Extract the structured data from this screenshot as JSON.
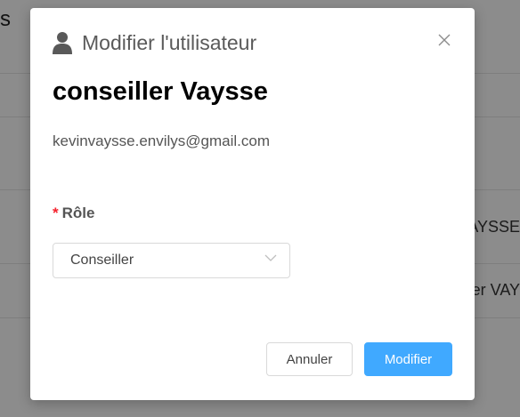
{
  "background": {
    "title_fragment": "s",
    "row_cells": [
      "AYSSE",
      "er VAY"
    ]
  },
  "modal": {
    "title": "Modifier l'utilisateur",
    "user_icon": "user-icon",
    "close_icon": "close-icon",
    "user_name": "conseiller Vaysse",
    "email": "kevinvaysse.envilys@gmail.com",
    "role_field": {
      "required_marker": "*",
      "label": "Rôle",
      "selected": "Conseiller",
      "arrow_icon": "chevron-down-icon"
    },
    "buttons": {
      "cancel": "Annuler",
      "ok": "Modifier"
    }
  },
  "colors": {
    "primary": "#40a9ff",
    "required": "#f5222d"
  }
}
